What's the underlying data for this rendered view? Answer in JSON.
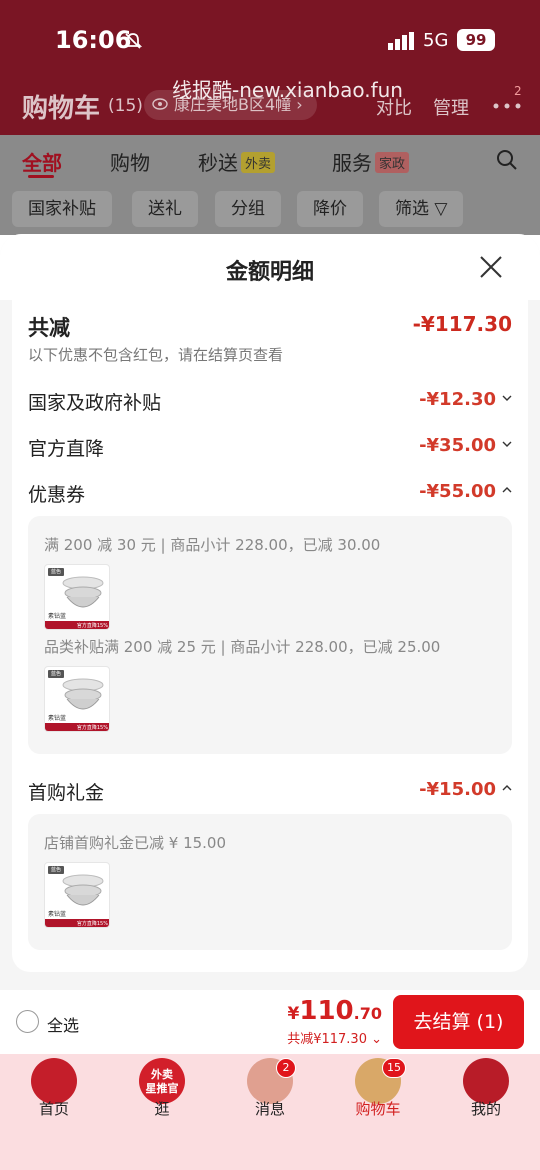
{
  "status_bar": {
    "time": "16:06",
    "network": "5G",
    "battery": "99"
  },
  "watermark": "线报酷-new.xianbao.fun",
  "cart_header": {
    "title": "购物车",
    "count": "(15)",
    "address": "康庄美地B区4幢",
    "compare": "对比",
    "manage": "管理",
    "more_badge": "2"
  },
  "tabs": [
    {
      "label": "全部"
    },
    {
      "label": "购物"
    },
    {
      "label": "秒送",
      "tag": "外卖"
    },
    {
      "label": "服务",
      "tag": "家政"
    }
  ],
  "filters": [
    "国家补贴",
    "送礼",
    "分组",
    "降价",
    "筛选"
  ],
  "modal": {
    "title": "金额明细",
    "total": {
      "label": "共减",
      "value": "-¥117.30",
      "hint": "以下优惠不包含红包，请在结算页查看"
    },
    "rows": [
      {
        "label": "国家及政府补贴",
        "value": "-¥12.30"
      },
      {
        "label": "官方直降",
        "value": "-¥35.00"
      },
      {
        "label": "优惠券",
        "value": "-¥55.00"
      }
    ],
    "coupon_details": [
      "满 200 减 30 元 | 商品小计 228.00，已减 30.00",
      "品类补贴满 200 减 25 元 | 商品小计 228.00，已减 25.00"
    ],
    "gift": {
      "label": "首购礼金",
      "value": "-¥15.00",
      "detail": "店铺首购礼金已减 ¥ 15.00"
    },
    "product_thumb": {
      "brand": "蓝色",
      "name": "素钻蓝",
      "promo": "官方直降15%"
    }
  },
  "checkout": {
    "select_all": "全选",
    "price_symbol": "¥",
    "price_int": "110",
    "price_dec": ".70",
    "discount": "共减¥117.30",
    "button": "去结算 (1)"
  },
  "tab_bar": {
    "items": [
      {
        "label": "首页"
      },
      {
        "label": "逛",
        "icon_text": "外卖\n星推官"
      },
      {
        "label": "消息",
        "badge": "2"
      },
      {
        "label": "购物车",
        "badge": "15"
      },
      {
        "label": "我的"
      }
    ]
  },
  "colors": {
    "accent": "#e0151b",
    "discount": "#d23a2a",
    "header_bg": "#7a1524"
  }
}
